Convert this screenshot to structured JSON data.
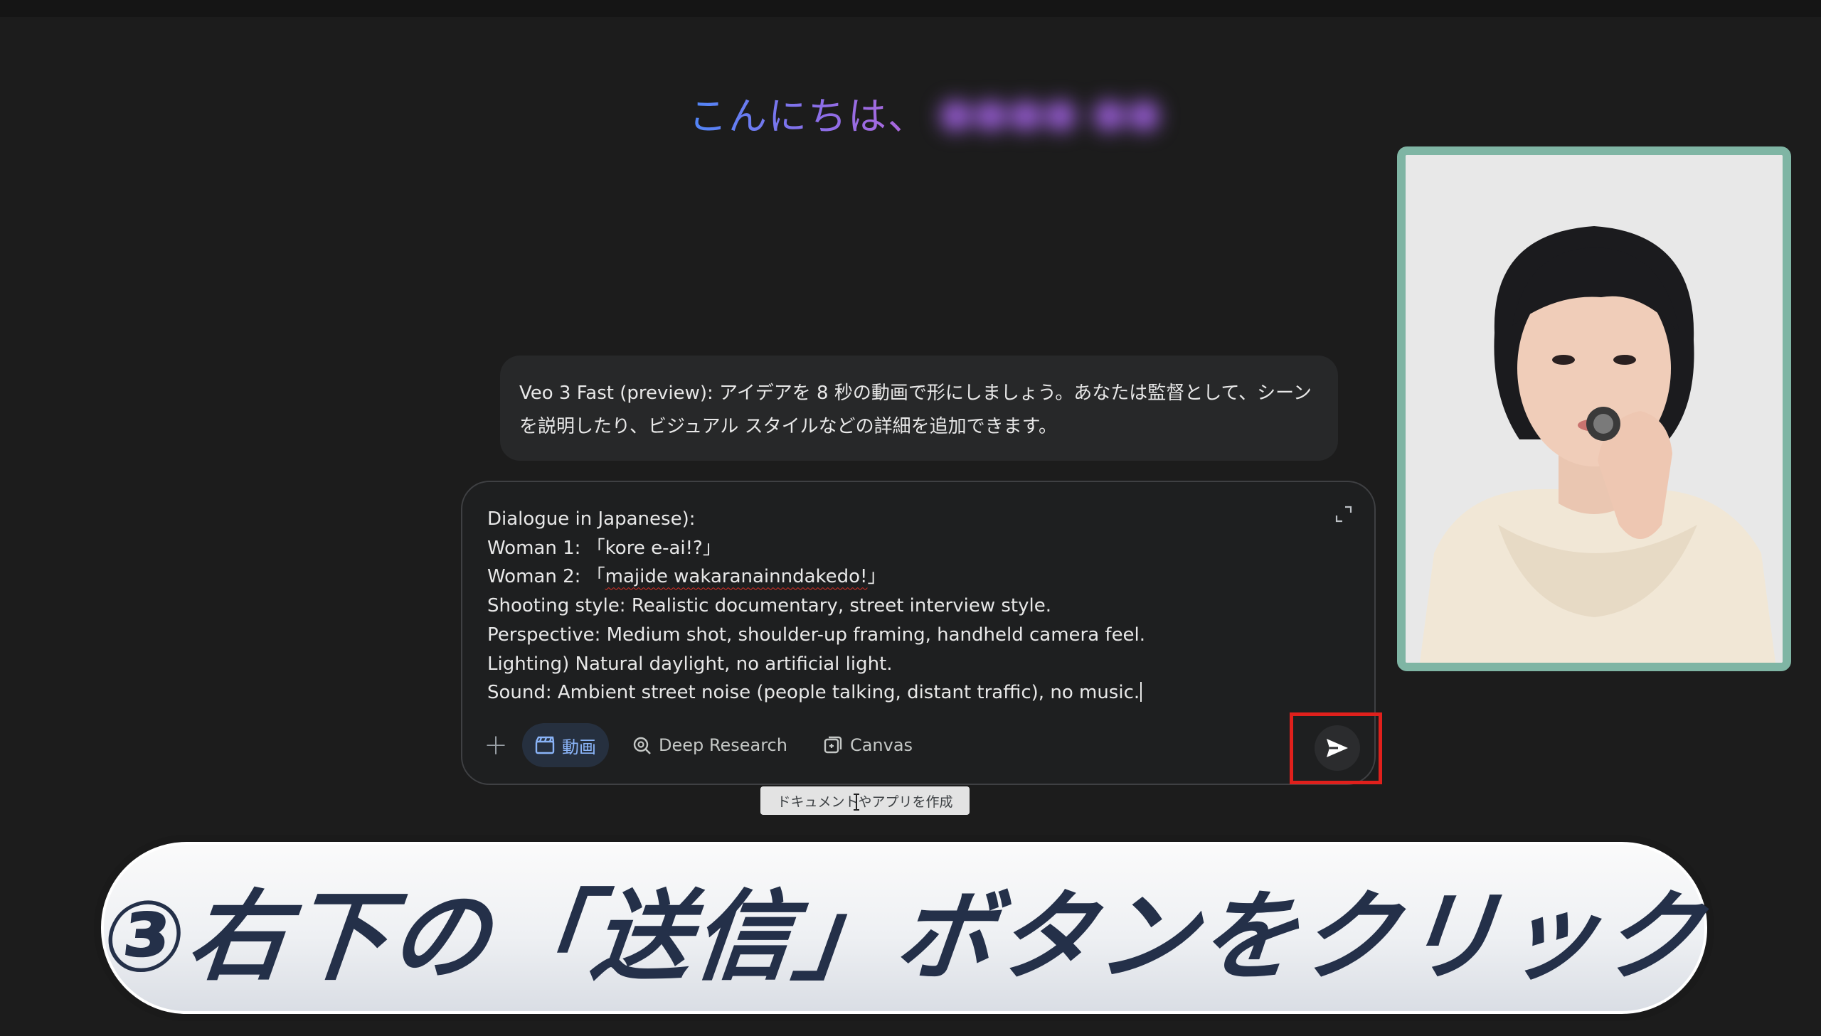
{
  "greeting": {
    "hello": "こんにちは、",
    "name": "●●●● ●●"
  },
  "info_bubble": {
    "line1": "Veo 3 Fast (preview): アイデアを 8 秒の動画で形にしましょう。あなたは監督として、シーン",
    "line2": "を説明したり、ビジュアル スタイルなどの詳細を追加できます。"
  },
  "prompt": {
    "lines": [
      "Dialogue in Japanese):",
      "Woman 1: 「kore e-ai!?」",
      "Woman 2: 「",
      "Shooting style: Realistic documentary, street interview style.",
      "Perspective: Medium shot, shoulder-up framing, handheld camera feel.",
      "Lighting) Natural daylight, no artificial light.",
      "Sound: Ambient street noise (people talking, distant traffic), no music."
    ],
    "woman2_spell": "majide wakaranainndakedo!",
    "woman2_end": "」"
  },
  "toolbar": {
    "video_label": "動画",
    "deep_research_label": "Deep Research",
    "canvas_label": "Canvas"
  },
  "tooltip": "ドキュメントやアプリを作成",
  "caption": "③右下の「送信」ボタンをクリック",
  "colors": {
    "accent_blue": "#8ab4f8",
    "highlight_red": "#e0201c",
    "webcam_border": "#7fb5a4",
    "caption_text": "#243049"
  }
}
